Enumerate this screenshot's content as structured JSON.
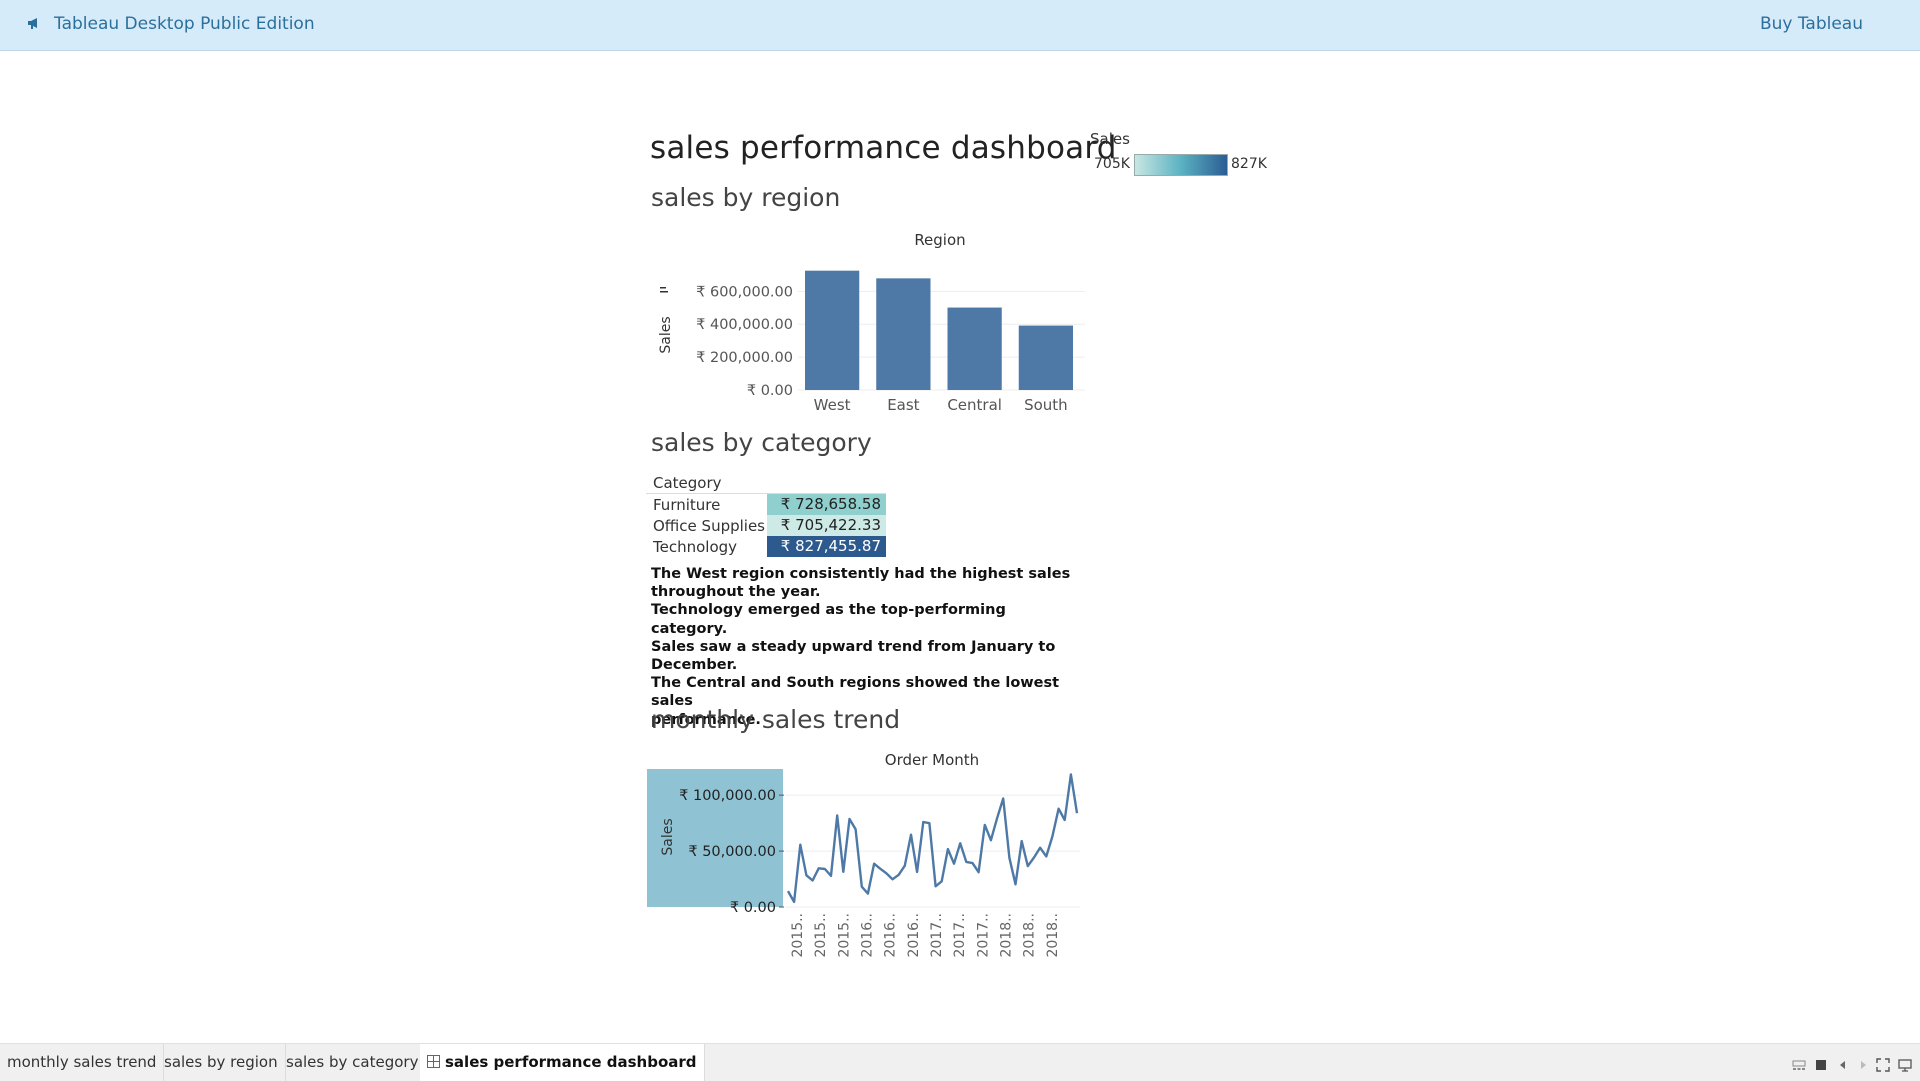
{
  "topbar": {
    "app_title": "Tableau Desktop Public Edition",
    "buy_label": "Buy Tableau",
    "accent": "#2b6f9c",
    "background": "#d6ebfa"
  },
  "dashboard": {
    "title": "sales performance dashboard",
    "legend": {
      "title": "Sales",
      "min_label": "705K",
      "max_label": "827K"
    }
  },
  "sections": {
    "region": "sales by region",
    "category": "sales by category",
    "trend": "monthly sales trend"
  },
  "insights": [
    "The West region consistently had the highest sales",
    "throughout the year.",
    "Technology emerged as the top-performing category.",
    "Sales saw a steady upward trend from January to",
    "December.",
    "The Central and South regions showed the lowest sales",
    "performance."
  ],
  "chart_data": [
    {
      "type": "bar",
      "title": "Region",
      "ylabel": "Sales",
      "categories": [
        "West",
        "East",
        "Central",
        "South"
      ],
      "values": [
        725458,
        678781,
        501240,
        391722
      ],
      "yticks": [
        "₹ 600,000.00",
        "₹ 400,000.00",
        "₹ 200,000.00",
        "₹ 0.00"
      ],
      "ytick_values": [
        600000,
        400000,
        200000,
        0
      ],
      "ylim": [
        0,
        760000
      ],
      "color": "#4e79a7",
      "grid": true
    },
    {
      "type": "table",
      "header": "Category",
      "rows": [
        {
          "category": "Furniture",
          "value": "₹ 728,658.58",
          "color": "#8fcfce",
          "text_color": "#222222"
        },
        {
          "category": "Office Supplies",
          "value": "₹ 705,422.33",
          "color": "#cdeae6",
          "text_color": "#222222"
        },
        {
          "category": "Technology",
          "value": "₹ 827,455.87",
          "color": "#2c5a8e",
          "text_color": "#ffffff"
        }
      ]
    },
    {
      "type": "line",
      "title": "Order Month",
      "ylabel": "Sales",
      "yticks": [
        "₹ 100,000.00",
        "₹ 50,000.00",
        "₹ 0.00"
      ],
      "ytick_values": [
        100000,
        50000,
        0
      ],
      "ylim": [
        0,
        118000
      ],
      "xticks": [
        "2015..",
        "2015..",
        "2015..",
        "2016..",
        "2016..",
        "2016..",
        "2017..",
        "2017..",
        "2017..",
        "2018..",
        "2018..",
        "2018.."
      ],
      "color": "#4e79a7",
      "ylabel_band_color": "#8fc3d4",
      "values": [
        14237,
        4520,
        55691,
        28295,
        23648,
        34595,
        33946,
        27909,
        81777,
        31453,
        78629,
        69546,
        18174,
        11951,
        38726,
        34195,
        30132,
        24797,
        28765,
        36898,
        64596,
        31405,
        75973,
        74920,
        18542,
        22979,
        51716,
        38750,
        56988,
        40344,
        39262,
        31115,
        73410,
        59688,
        79412,
        96999,
        43971,
        20301,
        58872,
        36522,
        44261,
        52982,
        45264,
        63120,
        87867,
        77777,
        118448,
        83829
      ]
    }
  ],
  "tabs": [
    {
      "label": "monthly sales trend"
    },
    {
      "label": "sales by region"
    },
    {
      "label": "sales by category"
    },
    {
      "label": "sales performance dashboard"
    }
  ]
}
